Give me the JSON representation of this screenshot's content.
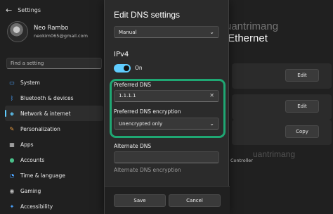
{
  "window": {
    "title": "Settings"
  },
  "profile": {
    "name": "Neo Rambo",
    "email": "neokim065@gmail.com"
  },
  "search": {
    "placeholder": "Find a setting"
  },
  "nav": [
    {
      "label": "System",
      "icon": "monitor-icon",
      "glyph": "▭",
      "color": "#4aa3ff"
    },
    {
      "label": "Bluetooth & devices",
      "icon": "bluetooth-icon",
      "glyph": "ᛒ",
      "color": "#4aa3ff"
    },
    {
      "label": "Network & internet",
      "icon": "wifi-icon",
      "glyph": "◈",
      "color": "#60cdff"
    },
    {
      "label": "Personalization",
      "icon": "brush-icon",
      "glyph": "✎",
      "color": "#f0a040"
    },
    {
      "label": "Apps",
      "icon": "apps-icon",
      "glyph": "▦",
      "color": "#c9c9c9"
    },
    {
      "label": "Accounts",
      "icon": "person-icon",
      "glyph": "●",
      "color": "#4ac08a"
    },
    {
      "label": "Time & language",
      "icon": "globe-clock-icon",
      "glyph": "◔",
      "color": "#4aa3ff"
    },
    {
      "label": "Gaming",
      "icon": "gamepad-icon",
      "glyph": "◉",
      "color": "#bbbbbb"
    },
    {
      "label": "Accessibility",
      "icon": "accessibility-icon",
      "glyph": "✦",
      "color": "#4aa3ff"
    }
  ],
  "page": {
    "title": "› Ethernet"
  },
  "right_panel": {
    "edit_label_1": "Edit",
    "edit_label_2": "Edit",
    "copy_label": "Copy",
    "controller_text": "Controller"
  },
  "dialog": {
    "title": "Edit DNS settings",
    "mode_select": "Manual",
    "section": "IPv4",
    "toggle_label": "On",
    "preferred_dns_label": "Preferred DNS",
    "preferred_dns_value": "1.1.1.1",
    "preferred_encryption_label": "Preferred DNS encryption",
    "preferred_encryption_value": "Unencrypted only",
    "alternate_dns_label": "Alternate DNS",
    "alternate_dns_value": "",
    "alternate_encryption_label": "Alternate DNS encryption",
    "save_label": "Save",
    "cancel_label": "Cancel"
  },
  "watermark": {
    "text": "uantrimang"
  },
  "colors": {
    "accent": "#60cdff",
    "highlight": "#1fa773"
  }
}
